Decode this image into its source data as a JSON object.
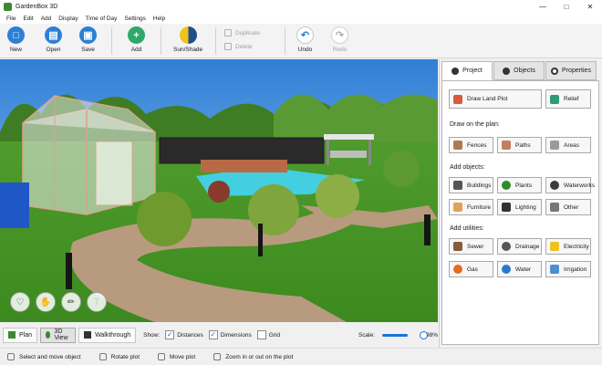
{
  "window": {
    "title": "GardenBox 3D"
  },
  "menu": [
    "File",
    "Edit",
    "Add",
    "Display",
    "Time of Day",
    "Settings",
    "Help"
  ],
  "toolbar": {
    "new": "New",
    "open": "Open",
    "save": "Save",
    "add": "Add",
    "sun_shade": "Sun/Shade",
    "duplicate": "Duplicate",
    "delete": "Delete",
    "undo": "Undo",
    "redo": "Redo"
  },
  "panel": {
    "tabs": [
      "Project",
      "Objects",
      "Properties"
    ],
    "draw_land_plot": "Draw Land Plot",
    "relief": "Relief",
    "draw_on_plan": "Draw on the plan:",
    "draw_items": [
      "Fences",
      "Paths",
      "Areas"
    ],
    "add_objects": "Add objects:",
    "object_items": [
      "Buildings",
      "Plants",
      "Waterworks",
      "Furniture",
      "Lighting",
      "Other"
    ],
    "add_utilities": "Add utilities:",
    "utility_items": [
      "Sewer",
      "Drainage",
      "Electricity",
      "Gas",
      "Water",
      "Irrigation"
    ]
  },
  "viewbar": {
    "plan": "Plan",
    "view3d": "3D View",
    "walkthrough": "Walkthrough",
    "show": "Show:",
    "distances": "Distances",
    "dimensions": "Dimensions",
    "grid": "Grid",
    "distances_checked": true,
    "dimensions_checked": true,
    "grid_checked": false,
    "scale_label": "Scale:",
    "scale_value": "98%",
    "scale_fraction": 0.98
  },
  "status": [
    "Select and move object",
    "Rotate plot",
    "Move plot",
    "Zoom in or out on the plot"
  ],
  "icons": {
    "new": "new-icon",
    "open": "folder-icon",
    "save": "save-icon",
    "add": "plus-icon",
    "sun": "sun-shade-icon",
    "undo": "undo-icon",
    "redo": "redo-icon"
  },
  "colors": {
    "accent": "#1a73d9",
    "toolbar_blue": "#2c7fd3",
    "add_green": "#2fa86a"
  }
}
